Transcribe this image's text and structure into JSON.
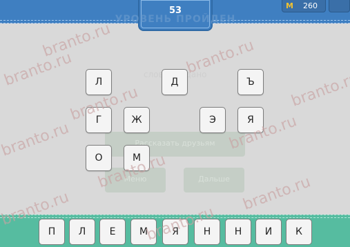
{
  "header": {
    "level": "53",
    "level_caption": "УРОВЕНЬ ПРОЙДЕН",
    "coins": "260",
    "coin_icon": "coin-icon"
  },
  "dialog": {
    "caption": "слово угадано",
    "share_label": "Рассказать друзьям",
    "menu_label": "Меню",
    "next_label": "Дальше"
  },
  "letters": [
    "Л",
    "Д",
    "Ъ",
    "Г",
    "Ж",
    "Э",
    "Я",
    "О",
    "М"
  ],
  "answer": [
    "П",
    "Л",
    "Е",
    "М",
    "Я",
    "Н",
    "Н",
    "И",
    "К"
  ],
  "watermark": "branto.ru",
  "colors": {
    "header_blue": "#3f7fc1",
    "answer_green": "#56bca0",
    "background": "#d9d9d9"
  }
}
